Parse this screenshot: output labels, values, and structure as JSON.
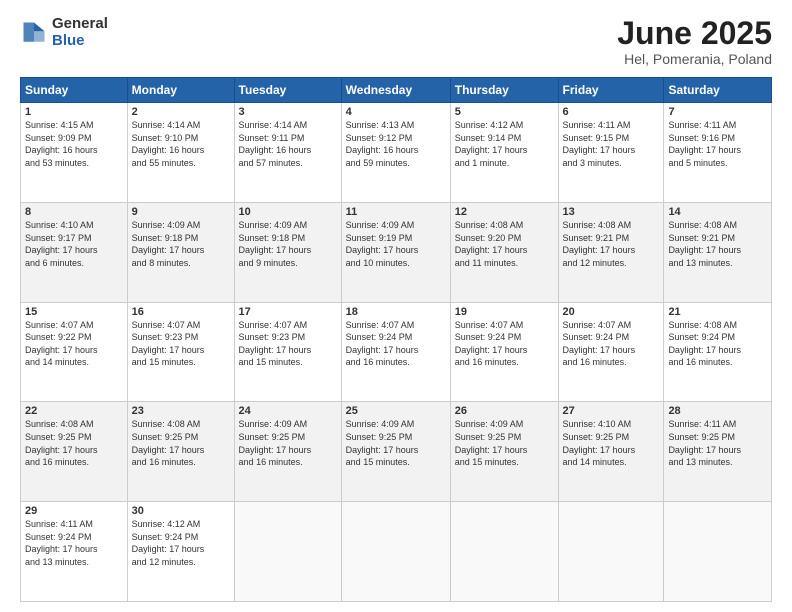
{
  "logo": {
    "general": "General",
    "blue": "Blue"
  },
  "title": "June 2025",
  "subtitle": "Hel, Pomerania, Poland",
  "headers": [
    "Sunday",
    "Monday",
    "Tuesday",
    "Wednesday",
    "Thursday",
    "Friday",
    "Saturday"
  ],
  "weeks": [
    [
      {
        "day": "1",
        "info": "Sunrise: 4:15 AM\nSunset: 9:09 PM\nDaylight: 16 hours\nand 53 minutes."
      },
      {
        "day": "2",
        "info": "Sunrise: 4:14 AM\nSunset: 9:10 PM\nDaylight: 16 hours\nand 55 minutes."
      },
      {
        "day": "3",
        "info": "Sunrise: 4:14 AM\nSunset: 9:11 PM\nDaylight: 16 hours\nand 57 minutes."
      },
      {
        "day": "4",
        "info": "Sunrise: 4:13 AM\nSunset: 9:12 PM\nDaylight: 16 hours\nand 59 minutes."
      },
      {
        "day": "5",
        "info": "Sunrise: 4:12 AM\nSunset: 9:14 PM\nDaylight: 17 hours\nand 1 minute."
      },
      {
        "day": "6",
        "info": "Sunrise: 4:11 AM\nSunset: 9:15 PM\nDaylight: 17 hours\nand 3 minutes."
      },
      {
        "day": "7",
        "info": "Sunrise: 4:11 AM\nSunset: 9:16 PM\nDaylight: 17 hours\nand 5 minutes."
      }
    ],
    [
      {
        "day": "8",
        "info": "Sunrise: 4:10 AM\nSunset: 9:17 PM\nDaylight: 17 hours\nand 6 minutes."
      },
      {
        "day": "9",
        "info": "Sunrise: 4:09 AM\nSunset: 9:18 PM\nDaylight: 17 hours\nand 8 minutes."
      },
      {
        "day": "10",
        "info": "Sunrise: 4:09 AM\nSunset: 9:18 PM\nDaylight: 17 hours\nand 9 minutes."
      },
      {
        "day": "11",
        "info": "Sunrise: 4:09 AM\nSunset: 9:19 PM\nDaylight: 17 hours\nand 10 minutes."
      },
      {
        "day": "12",
        "info": "Sunrise: 4:08 AM\nSunset: 9:20 PM\nDaylight: 17 hours\nand 11 minutes."
      },
      {
        "day": "13",
        "info": "Sunrise: 4:08 AM\nSunset: 9:21 PM\nDaylight: 17 hours\nand 12 minutes."
      },
      {
        "day": "14",
        "info": "Sunrise: 4:08 AM\nSunset: 9:21 PM\nDaylight: 17 hours\nand 13 minutes."
      }
    ],
    [
      {
        "day": "15",
        "info": "Sunrise: 4:07 AM\nSunset: 9:22 PM\nDaylight: 17 hours\nand 14 minutes."
      },
      {
        "day": "16",
        "info": "Sunrise: 4:07 AM\nSunset: 9:23 PM\nDaylight: 17 hours\nand 15 minutes."
      },
      {
        "day": "17",
        "info": "Sunrise: 4:07 AM\nSunset: 9:23 PM\nDaylight: 17 hours\nand 15 minutes."
      },
      {
        "day": "18",
        "info": "Sunrise: 4:07 AM\nSunset: 9:24 PM\nDaylight: 17 hours\nand 16 minutes."
      },
      {
        "day": "19",
        "info": "Sunrise: 4:07 AM\nSunset: 9:24 PM\nDaylight: 17 hours\nand 16 minutes."
      },
      {
        "day": "20",
        "info": "Sunrise: 4:07 AM\nSunset: 9:24 PM\nDaylight: 17 hours\nand 16 minutes."
      },
      {
        "day": "21",
        "info": "Sunrise: 4:08 AM\nSunset: 9:24 PM\nDaylight: 17 hours\nand 16 minutes."
      }
    ],
    [
      {
        "day": "22",
        "info": "Sunrise: 4:08 AM\nSunset: 9:25 PM\nDaylight: 17 hours\nand 16 minutes."
      },
      {
        "day": "23",
        "info": "Sunrise: 4:08 AM\nSunset: 9:25 PM\nDaylight: 17 hours\nand 16 minutes."
      },
      {
        "day": "24",
        "info": "Sunrise: 4:09 AM\nSunset: 9:25 PM\nDaylight: 17 hours\nand 16 minutes."
      },
      {
        "day": "25",
        "info": "Sunrise: 4:09 AM\nSunset: 9:25 PM\nDaylight: 17 hours\nand 15 minutes."
      },
      {
        "day": "26",
        "info": "Sunrise: 4:09 AM\nSunset: 9:25 PM\nDaylight: 17 hours\nand 15 minutes."
      },
      {
        "day": "27",
        "info": "Sunrise: 4:10 AM\nSunset: 9:25 PM\nDaylight: 17 hours\nand 14 minutes."
      },
      {
        "day": "28",
        "info": "Sunrise: 4:11 AM\nSunset: 9:25 PM\nDaylight: 17 hours\nand 13 minutes."
      }
    ],
    [
      {
        "day": "29",
        "info": "Sunrise: 4:11 AM\nSunset: 9:24 PM\nDaylight: 17 hours\nand 13 minutes."
      },
      {
        "day": "30",
        "info": "Sunrise: 4:12 AM\nSunset: 9:24 PM\nDaylight: 17 hours\nand 12 minutes."
      },
      {
        "day": "",
        "info": ""
      },
      {
        "day": "",
        "info": ""
      },
      {
        "day": "",
        "info": ""
      },
      {
        "day": "",
        "info": ""
      },
      {
        "day": "",
        "info": ""
      }
    ]
  ]
}
